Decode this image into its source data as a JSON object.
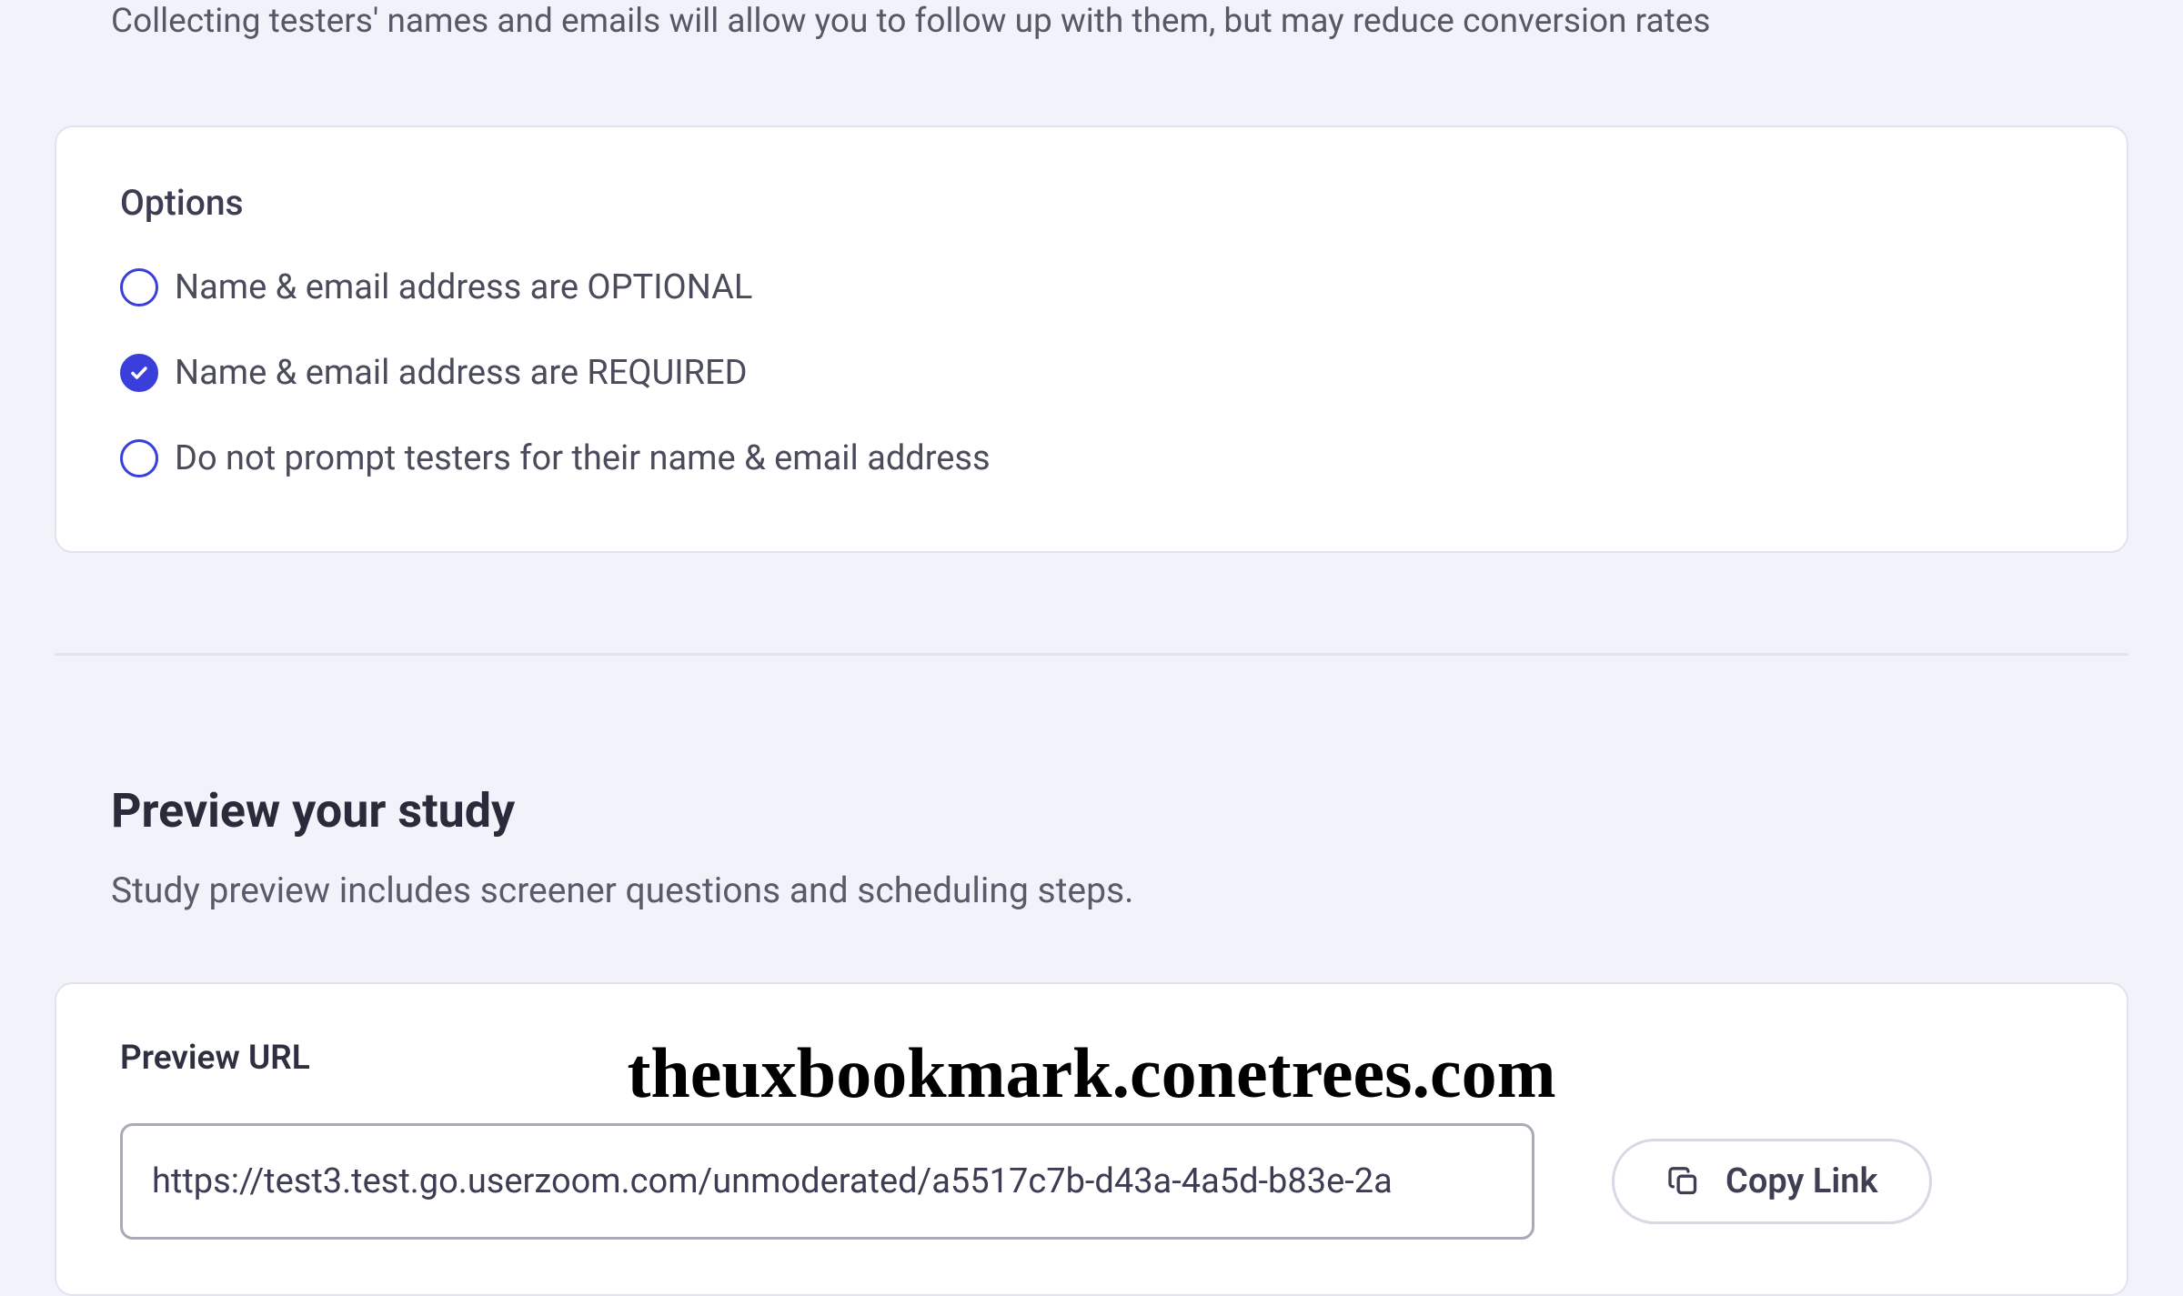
{
  "intro_text": "Collecting testers' names and emails will allow you to follow up with them, but may reduce conversion rates",
  "options_card": {
    "heading": "Options",
    "items": [
      {
        "label": "Name & email address are OPTIONAL",
        "selected": false
      },
      {
        "label": "Name & email address are REQUIRED",
        "selected": true
      },
      {
        "label": "Do not prompt testers for their name & email address",
        "selected": false
      }
    ]
  },
  "preview_section": {
    "heading": "Preview your study",
    "subtext": "Study preview includes screener questions and scheduling steps.",
    "url_label": "Preview URL",
    "url_value": "https://test3.test.go.userzoom.com/unmoderated/a5517c7b-d43a-4a5d-b83e-2a",
    "copy_button_label": "Copy Link"
  },
  "watermark": "theuxbookmark.conetrees.com"
}
